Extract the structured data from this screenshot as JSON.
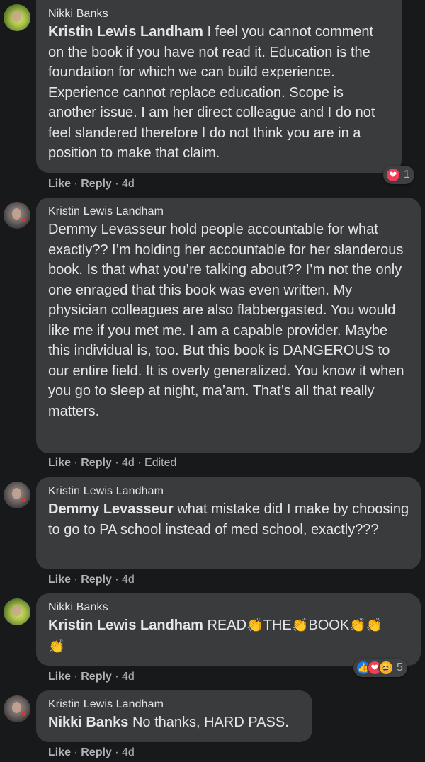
{
  "comments": [
    {
      "author": "Nikki Banks",
      "mention": "Kristin Lewis Landham",
      "text": " I feel you cannot comment on the book if you have not read it. Education is the foundation for which we can build experience. Experience cannot replace education. Scope is another issue. I am her direct colleague and I do not feel slandered therefore I do not think you are in a position to make that claim.",
      "like": "Like",
      "reply": "Reply",
      "time": "4d",
      "reaction_count": "1"
    },
    {
      "author": "Kristin Lewis Landham",
      "text": "Demmy Levasseur hold people accountable for what exactly?? I’m holding her accountable for her slanderous book. Is that what you’re talking about?? I’m not the only one enraged that this book was even written. My physician colleagues are also flabbergasted. You would like me if you met me. I am a capable provider. Maybe this individual is, too. But this book is DANGEROUS to our entire field. It is overly generalized. You know it when you go to sleep at night, ma’am. That’s all that really matters.",
      "like": "Like",
      "reply": "Reply",
      "time": "4d",
      "edited": "Edited"
    },
    {
      "author": "Kristin Lewis Landham",
      "mention": "Demmy Levasseur",
      "text": " what mistake did I make by choosing to go to PA school instead of med school, exactly???",
      "like": "Like",
      "reply": "Reply",
      "time": "4d"
    },
    {
      "author": "Nikki Banks",
      "mention": "Kristin Lewis Landham",
      "words": [
        " READ",
        "THE",
        "BOOK"
      ],
      "clap": "👏",
      "like": "Like",
      "reply": "Reply",
      "time": "4d",
      "reaction_count": "5"
    },
    {
      "author": "Kristin Lewis Landham",
      "mention": "Nikki Banks",
      "text": " No thanks, HARD PASS.",
      "like": "Like",
      "reply": "Reply",
      "time": "4d"
    }
  ],
  "icons": {
    "love": "❤",
    "like": "👍",
    "haha": "😆"
  },
  "colors": {
    "background": "#18191a",
    "bubble": "#3a3b3c",
    "text": "#e4e6eb",
    "secondary": "#b0b3b8",
    "love": "#f33e58",
    "like": "#1877f2"
  },
  "separator": " · "
}
